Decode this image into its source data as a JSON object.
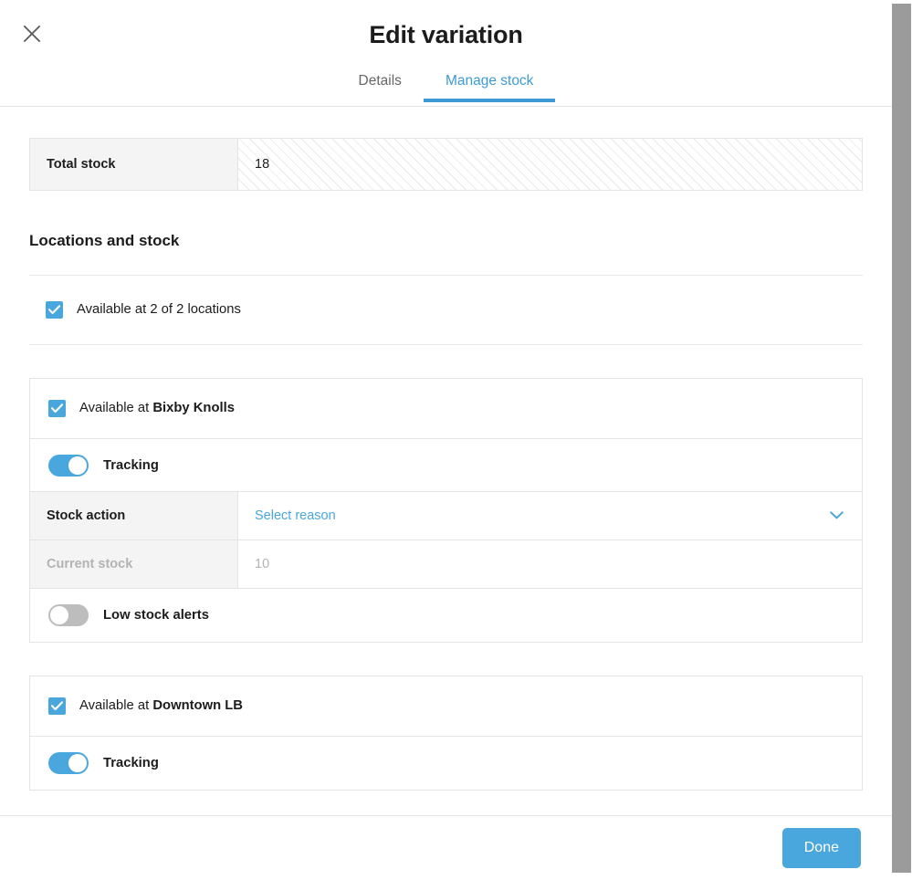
{
  "modal": {
    "title": "Edit variation",
    "close_icon": "close-icon",
    "tabs": [
      {
        "label": "Details",
        "active": false
      },
      {
        "label": "Manage stock",
        "active": true
      }
    ]
  },
  "total_stock": {
    "label": "Total stock",
    "value": "18"
  },
  "locations_section": {
    "heading": "Locations and stock",
    "all_locations": {
      "label_prefix": "Available at 2 of 2 locations",
      "checked": true
    }
  },
  "location_cards": [
    {
      "available_prefix": "Available at ",
      "name": "Bixby Knolls",
      "checked": true,
      "tracking": {
        "label": "Tracking",
        "on": true
      },
      "stock_action": {
        "label": "Stock action",
        "value": "Select reason",
        "chevron_icon": "chevron-down-icon"
      },
      "current_stock": {
        "label": "Current stock",
        "value": "10",
        "disabled": true
      },
      "low_stock_alerts": {
        "label": "Low stock alerts",
        "on": false
      }
    },
    {
      "available_prefix": "Available at ",
      "name": "Downtown LB",
      "checked": true,
      "tracking": {
        "label": "Tracking",
        "on": true
      }
    }
  ],
  "footer": {
    "done_label": "Done"
  },
  "colors": {
    "accent_blue": "#4aa7dd",
    "tab_blue": "#3d9ad4",
    "border_gray": "#e4e4e4",
    "label_bg": "#f4f4f4",
    "disabled_text": "#b3b3b3",
    "scrollbar_thumb": "#9b9b9b"
  }
}
